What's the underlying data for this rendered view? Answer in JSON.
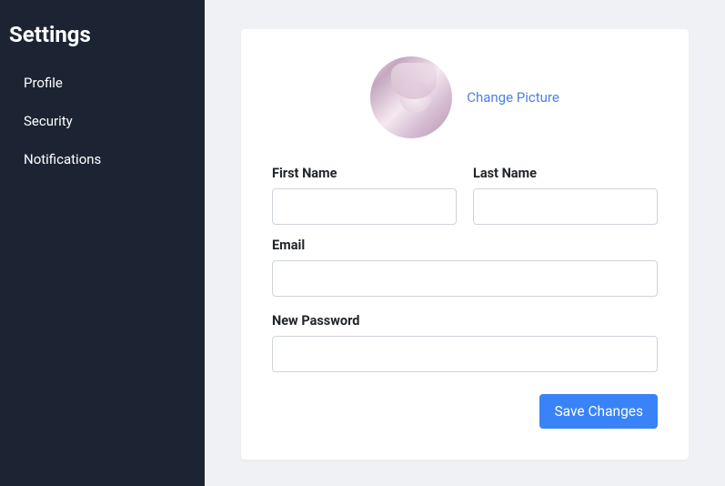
{
  "sidebar": {
    "title": "Settings",
    "items": [
      {
        "label": "Profile"
      },
      {
        "label": "Security"
      },
      {
        "label": "Notifications"
      }
    ]
  },
  "profile": {
    "change_picture_label": "Change Picture",
    "first_name_label": "First Name",
    "first_name_value": "",
    "last_name_label": "Last Name",
    "last_name_value": "",
    "email_label": "Email",
    "email_value": "",
    "new_password_label": "New Password",
    "new_password_value": "",
    "save_label": "Save Changes"
  }
}
